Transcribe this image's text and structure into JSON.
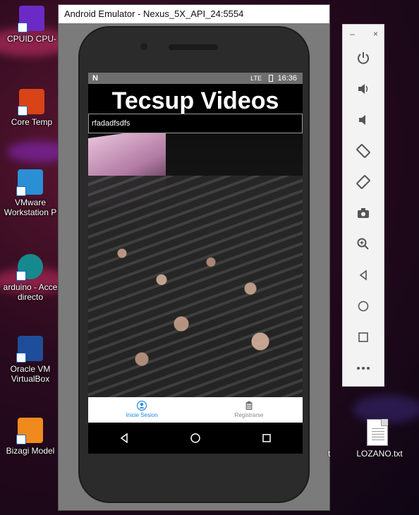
{
  "desktop": {
    "icons": [
      {
        "label": "CPUID CPU-"
      },
      {
        "label": "Core Temp"
      },
      {
        "label": "VMware Workstation P"
      },
      {
        "label": "arduino - Acce directo"
      },
      {
        "label": "Oracle VM VirtualBox"
      },
      {
        "label": "Bizagi Model"
      }
    ],
    "file": {
      "label": "LOZANO.txt"
    },
    "partial_label": "t"
  },
  "emulator": {
    "window_title": "Android Emulator - Nexus_5X_API_24:5554",
    "status_bar": {
      "time": "16:36",
      "network": "LTE"
    },
    "app": {
      "title": "Tecsup Videos",
      "search_value": "rfadadfsdfs",
      "bottom_nav": [
        {
          "label": "Inicie Sesion",
          "active": true
        },
        {
          "label": "Registrarse",
          "active": false
        }
      ]
    },
    "accent_color": "#1e88e5"
  },
  "toolbar": {
    "window_controls": [
      "minimize",
      "close"
    ],
    "tools": [
      "power-icon",
      "volume-up-icon",
      "volume-down-icon",
      "rotate-left-icon",
      "rotate-right-icon",
      "camera-icon",
      "zoom-icon",
      "back-icon",
      "home-icon",
      "overview-icon",
      "more-icon"
    ]
  }
}
